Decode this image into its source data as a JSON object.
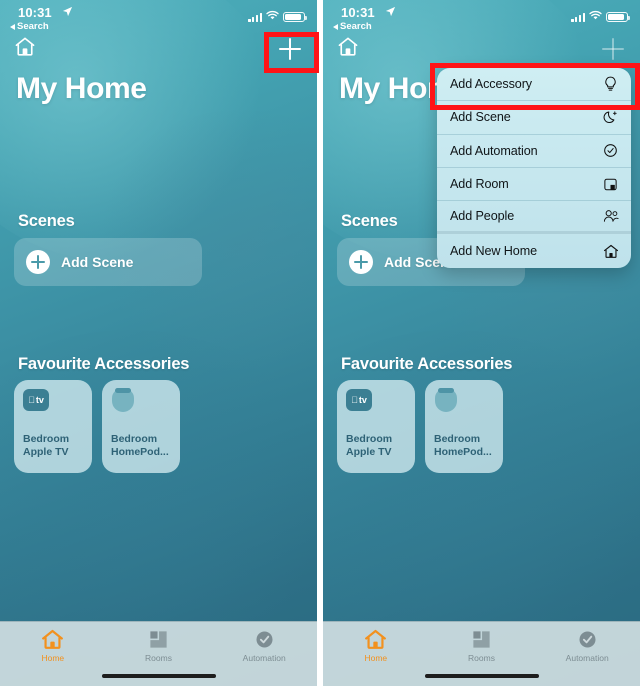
{
  "meta": {
    "app_name": "Home",
    "screen_title": "My Home"
  },
  "status_bar": {
    "time": "10:31",
    "back_label": "Search",
    "location_icon": "location-arrow-icon",
    "cellular_icon": "cellular-signal-icon",
    "wifi_icon": "wifi-icon",
    "battery_icon": "battery-icon"
  },
  "nav": {
    "home_icon": "home-icon",
    "add_button_label": "+",
    "add_button_icon": "plus-icon"
  },
  "sections": {
    "scenes": {
      "title": "Scenes",
      "add_scene_label": "Add Scene",
      "add_scene_icon": "plus-circle-icon"
    },
    "favourites": {
      "title": "Favourite Accessories",
      "tiles": [
        {
          "name": "Bedroom\nApple TV",
          "line1": "Bedroom",
          "line2": "Apple TV",
          "icon": "apple-tv-icon"
        },
        {
          "name": "Bedroom HomePod…",
          "line1": "Bedroom",
          "line2": "HomePod...",
          "icon": "homepod-icon"
        }
      ]
    }
  },
  "menu": {
    "items": [
      {
        "label": "Add Accessory",
        "icon": "lightbulb-icon",
        "highlighted": true
      },
      {
        "label": "Add Scene",
        "icon": "moon-stars-icon",
        "highlighted": false
      },
      {
        "label": "Add Automation",
        "icon": "clock-check-icon",
        "highlighted": false
      },
      {
        "label": "Add Room",
        "icon": "room-square-icon",
        "highlighted": false
      },
      {
        "label": "Add People",
        "icon": "people-icon",
        "highlighted": false
      },
      {
        "label": "Add New Home",
        "icon": "home-outline-icon",
        "highlighted": false
      }
    ]
  },
  "tabbar": {
    "tabs": [
      {
        "label": "Home",
        "icon": "home-filled-icon",
        "active": true
      },
      {
        "label": "Rooms",
        "icon": "rooms-icon",
        "active": false
      },
      {
        "label": "Automation",
        "icon": "automation-icon",
        "active": false
      }
    ]
  },
  "annotations": {
    "box_1_target": "plus-button",
    "box_2_target": "menu-item-add-accessory",
    "color": "#ff1417"
  },
  "colors": {
    "wallpaper_top": "#4fb0bd",
    "wallpaper_bottom": "#2a6a80",
    "accent_active_tab": "#f2911e",
    "tile_bg": "#d2ebf0",
    "tile_text": "#2e6276",
    "menu_bg": "#cfeef3",
    "annotation_red": "#ff1417"
  }
}
